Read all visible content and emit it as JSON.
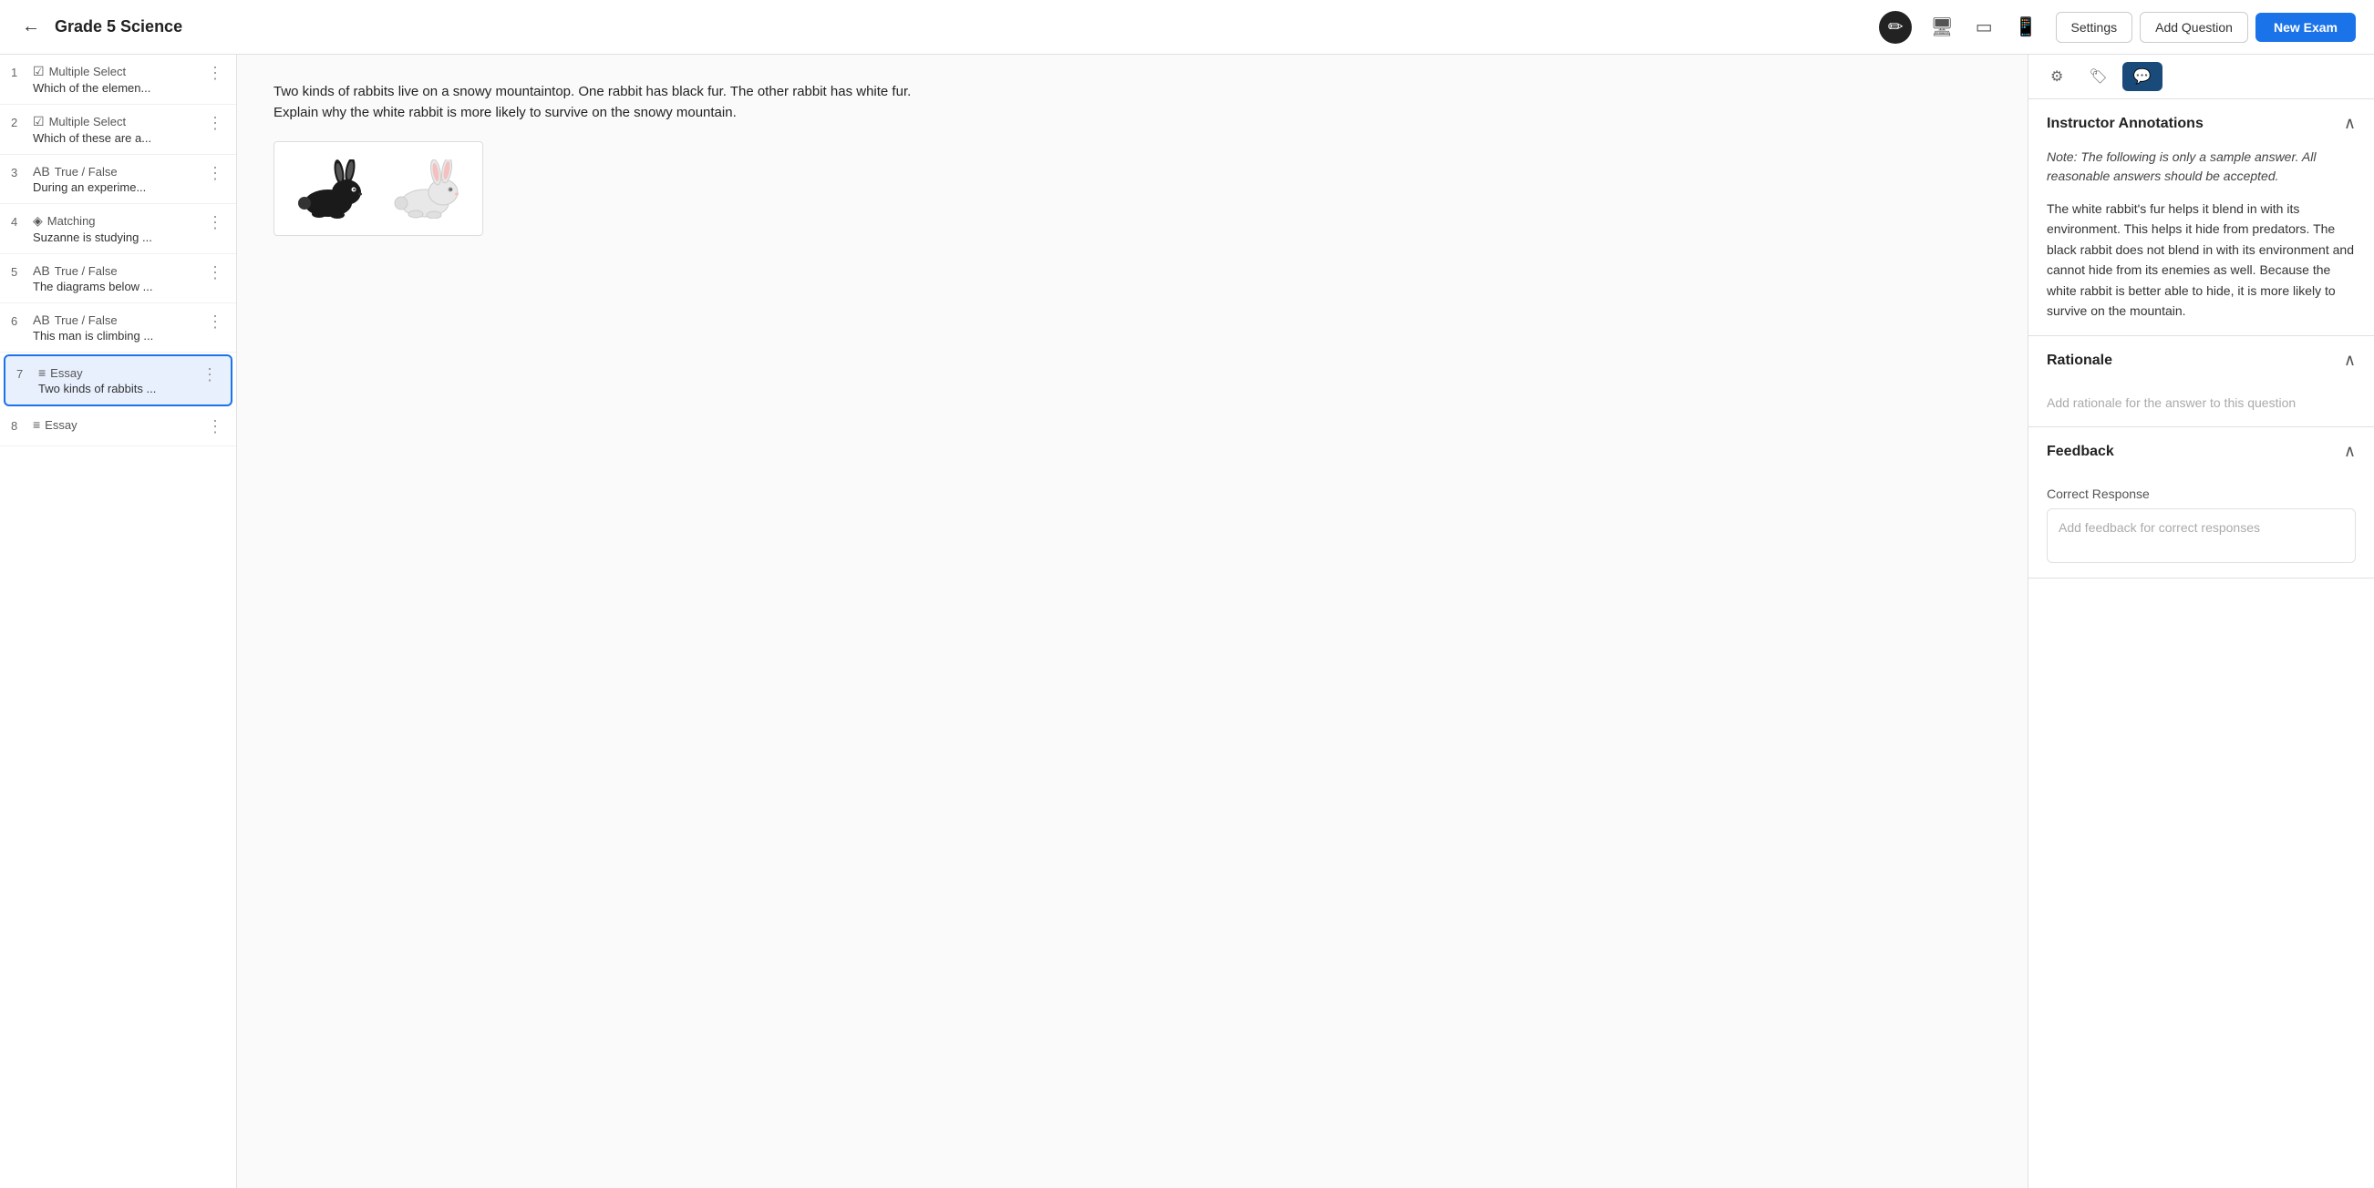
{
  "header": {
    "back_label": "←",
    "title": "Grade 5 Science",
    "icons": [
      {
        "name": "pencil-icon",
        "symbol": "✏",
        "active": true
      },
      {
        "name": "monitor-icon",
        "symbol": "🖥",
        "active": false
      },
      {
        "name": "tablet-icon",
        "symbol": "⬜",
        "active": false
      },
      {
        "name": "phone-icon",
        "symbol": "📱",
        "active": false
      }
    ],
    "settings_label": "Settings",
    "add_question_label": "Add Question",
    "new_exam_label": "New Exam"
  },
  "sidebar": {
    "items": [
      {
        "num": "1",
        "type": "Multiple Select",
        "type_icon": "☑",
        "preview": "Which of the elemen...",
        "active": false
      },
      {
        "num": "2",
        "type": "Multiple Select",
        "type_icon": "☑",
        "preview": "Which of these are a...",
        "active": false
      },
      {
        "num": "3",
        "type": "True / False",
        "type_icon": "AB",
        "preview": "During an experime...",
        "active": false
      },
      {
        "num": "4",
        "type": "Matching",
        "type_icon": "◈",
        "preview": "Suzanne is studying ...",
        "active": false
      },
      {
        "num": "5",
        "type": "True / False",
        "type_icon": "AB",
        "preview": "The diagrams below ...",
        "active": false
      },
      {
        "num": "6",
        "type": "True / False",
        "type_icon": "AB",
        "preview": "This man is climbing ...",
        "active": false
      },
      {
        "num": "7",
        "type": "Essay",
        "type_icon": "≡",
        "preview": "Two kinds of rabbits ...",
        "active": true
      },
      {
        "num": "8",
        "type": "Essay",
        "type_icon": "≡",
        "preview": "",
        "active": false
      }
    ]
  },
  "content": {
    "question_text": "Two kinds of rabbits live on a snowy mountaintop. One rabbit has black fur. The other rabbit has white fur. Explain why the white rabbit is more likely to survive on the snowy mountain."
  },
  "right_panel": {
    "tabs": [
      {
        "name": "settings-tab",
        "symbol": "⚙",
        "active": false
      },
      {
        "name": "tag-tab",
        "symbol": "🏷",
        "active": false
      },
      {
        "name": "chat-tab",
        "symbol": "💬",
        "active": true
      }
    ],
    "instructor_annotations": {
      "title": "Instructor Annotations",
      "note": "Note: The following is only a sample answer. All reasonable answers should be accepted.",
      "body": "The white rabbit's fur helps it blend in with its environment. This helps it hide from predators. The black rabbit does not blend in with its environment and cannot hide from its enemies as well. Because the white rabbit is better able to hide, it is more likely to survive on the mountain."
    },
    "rationale": {
      "title": "Rationale",
      "placeholder": "Add rationale for the answer to this question"
    },
    "feedback": {
      "title": "Feedback",
      "correct_response_label": "Correct Response",
      "correct_placeholder": "Add feedback for correct responses"
    }
  }
}
